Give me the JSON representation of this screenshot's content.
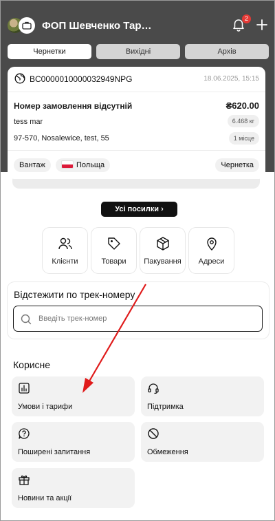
{
  "header": {
    "title": "ФОП Шевченко Тарас Г...",
    "notifications_count": "2",
    "avatar_icon": "avatar",
    "bag_icon": "briefcase-icon",
    "bell_icon": "bell-icon",
    "add_icon": "plus-icon"
  },
  "tabs": [
    {
      "label": "Чернетки",
      "active": true
    },
    {
      "label": "Вихідні",
      "active": false
    },
    {
      "label": "Архів",
      "active": false
    }
  ],
  "parcel": {
    "id": "BC0000010000032949NPG",
    "date": "18.06.2025, 15:15",
    "order_status": "Номер замовлення відсутній",
    "price": "₴620.00",
    "recipient": "tess mar",
    "weight": "6.468 кг",
    "address": "97-570, Nosalewice, test, 55",
    "places": "1 місце",
    "type": "Вантаж",
    "country": "Польща",
    "status": "Чернетка"
  },
  "all_parcels_button": "Усі посилки",
  "quick_actions": [
    {
      "label": "Клієнти",
      "icon": "users-icon"
    },
    {
      "label": "Товари",
      "icon": "tag-icon"
    },
    {
      "label": "Пакування",
      "icon": "box-icon"
    },
    {
      "label": "Адреси",
      "icon": "location-pin-icon"
    }
  ],
  "tracking": {
    "title": "Відстежити по трек-номеру",
    "placeholder": "Введіть трек-номер"
  },
  "useful": {
    "title": "Корисне",
    "items": [
      {
        "label": "Умови і тарифи",
        "icon": "chart-icon"
      },
      {
        "label": "Підтримка",
        "icon": "headset-icon"
      },
      {
        "label": "Поширені запитання",
        "icon": "question-icon"
      },
      {
        "label": "Обмеження",
        "icon": "restricted-icon"
      },
      {
        "label": "Новини та акції",
        "icon": "gift-icon"
      }
    ]
  },
  "colors": {
    "header_bg": "#4a4a4a",
    "accent_dark": "#111111",
    "badge": "#e53935",
    "annotation_arrow": "#e01b1b"
  }
}
